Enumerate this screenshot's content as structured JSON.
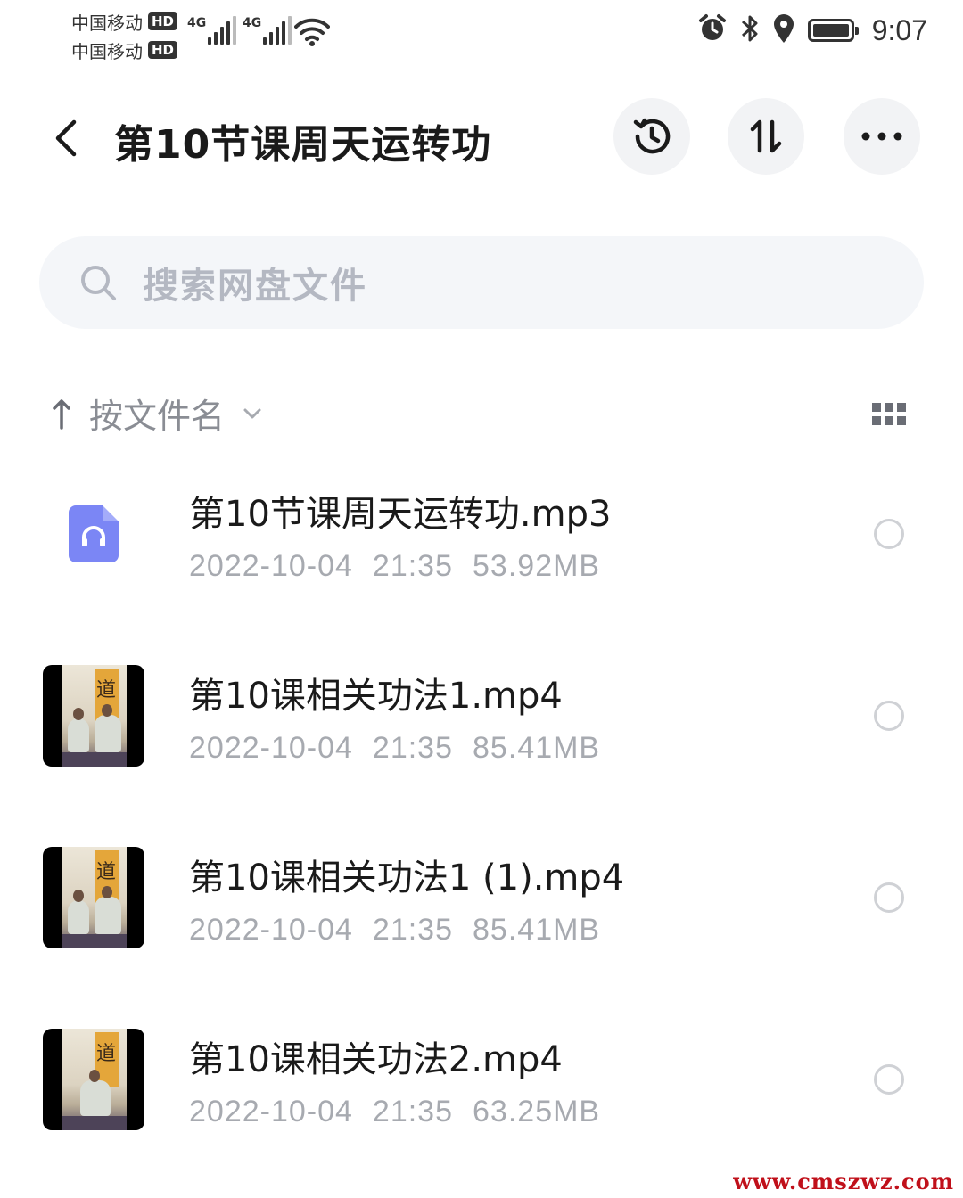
{
  "status_bar": {
    "carrier1": "中国移动",
    "carrier2": "中国移动",
    "hd_badge": "HD",
    "network1": "4G",
    "network2": "4G",
    "time": "9:07"
  },
  "header": {
    "title": "第10节课周天运转功",
    "icons": [
      "back-chevron-icon",
      "history-icon",
      "transfer-icon",
      "more-icon"
    ]
  },
  "search": {
    "placeholder": "搜索网盘文件"
  },
  "sort": {
    "label": "按文件名"
  },
  "files": [
    {
      "name": "第10节课周天运转功.mp3",
      "date": "2022-10-04",
      "time": "21:35",
      "size": "53.92MB",
      "type": "audio"
    },
    {
      "name": "第10课相关功法1.mp4",
      "date": "2022-10-04",
      "time": "21:35",
      "size": "85.41MB",
      "type": "video"
    },
    {
      "name": "第10课相关功法1 (1).mp4",
      "date": "2022-10-04",
      "time": "21:35",
      "size": "85.41MB",
      "type": "video"
    },
    {
      "name": "第10课相关功法2.mp4",
      "date": "2022-10-04",
      "time": "21:35",
      "size": "63.25MB",
      "type": "video"
    }
  ],
  "watermark": "www.cmszwz.com",
  "colors": {
    "accent_audio": "#7b86f5",
    "search_bg": "#f4f6f9",
    "meta_text": "#a7aab0"
  }
}
